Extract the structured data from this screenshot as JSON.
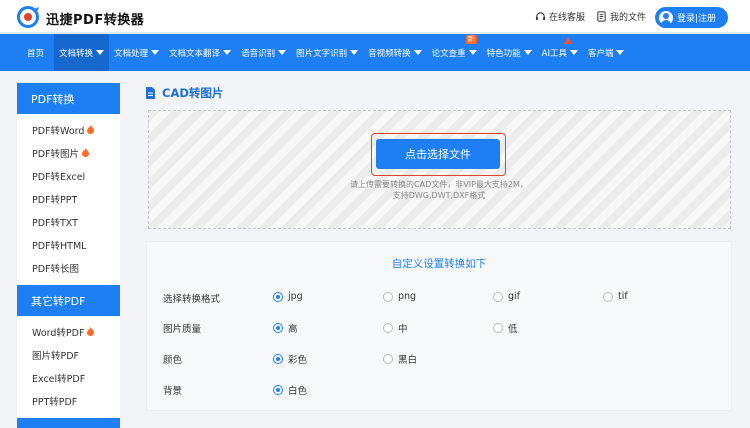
{
  "header": {
    "brand": "迅捷PDF转换器",
    "service_label": "在线客服",
    "files_label": "我的文件",
    "login_label": "登录|注册"
  },
  "nav": {
    "items": [
      {
        "label": "首页"
      },
      {
        "label": "文档转换"
      },
      {
        "label": "文档处理"
      },
      {
        "label": "文档文本翻译"
      },
      {
        "label": "语音识别"
      },
      {
        "label": "图片文字识别"
      },
      {
        "label": "音视频转换"
      },
      {
        "label": "论文查重"
      },
      {
        "label": "特色功能"
      },
      {
        "label": "AI工具"
      },
      {
        "label": "客户端"
      }
    ],
    "new_badge": "新"
  },
  "sidebar": {
    "section1": "PDF转换",
    "items1": [
      "PDF转Word",
      "PDF转图片",
      "PDF转Excel",
      "PDF转PPT",
      "PDF转TXT",
      "PDF转HTML",
      "PDF转长图"
    ],
    "section2": "其它转PDF",
    "items2": [
      "Word转PDF",
      "图片转PDF",
      "Excel转PDF",
      "PPT转PDF"
    ]
  },
  "main": {
    "title": "CAD转图片",
    "choose_label": "点击选择文件",
    "hint_line1": "请上传需要转换的CAD文件，非VIP最大支持2M，",
    "hint_line2": "支持DWG,DWT,DXF格式"
  },
  "settings": {
    "title": "自定义设置转换如下",
    "format_label": "选择转换格式",
    "formats": [
      "jpg",
      "png",
      "gif",
      "tif"
    ],
    "quality_label": "图片质量",
    "qualities": [
      "高",
      "中",
      "低"
    ],
    "color_label": "颜色",
    "colors": [
      "彩色",
      "黑白"
    ],
    "bg_label": "背景",
    "backgrounds": [
      "白色"
    ]
  },
  "colors": {
    "accent": "#1e7ff4",
    "nav_active": "#1668cf",
    "highlight": "#e0412a",
    "hot": "#ff6a2b"
  }
}
